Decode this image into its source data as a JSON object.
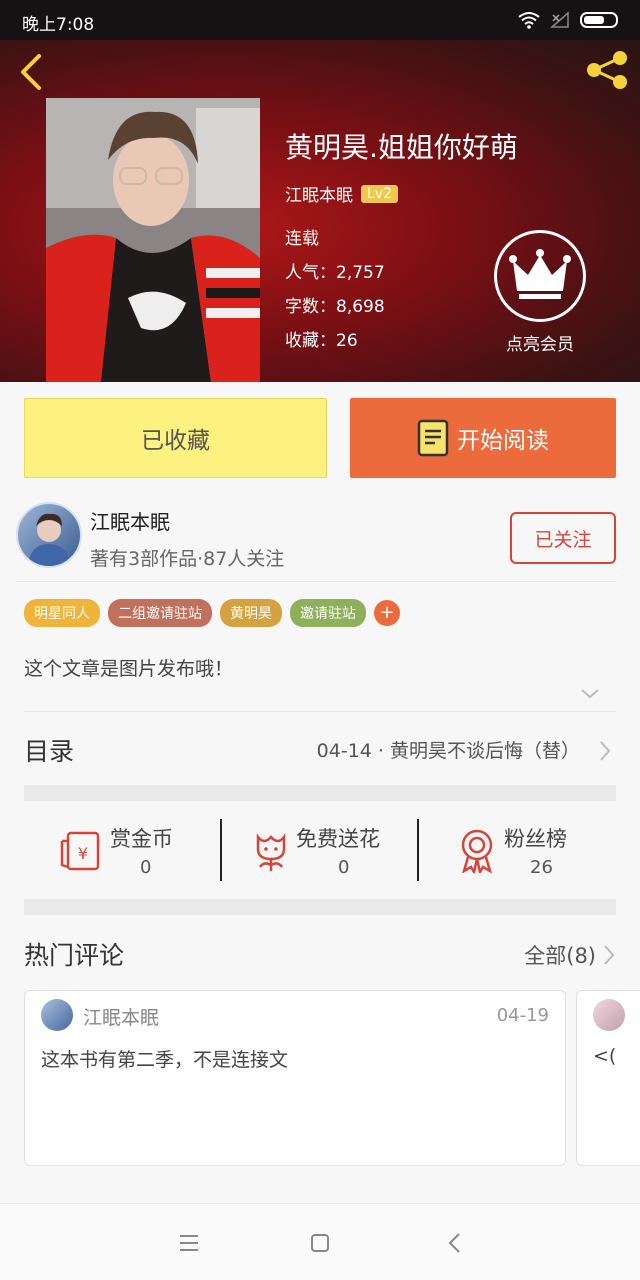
{
  "status_bar": {
    "time": "晚上7:08"
  },
  "book": {
    "title": "黄明昊.姐姐你好萌",
    "author": "江眠本眠",
    "level": "Lv2",
    "status": "连载",
    "popularity": "人气：2,757",
    "word_count": "字数：8,698",
    "favorites": "收藏：26",
    "member_label": "点亮会员"
  },
  "actions": {
    "collected_label": "已收藏",
    "read_label": "开始阅读"
  },
  "author_card": {
    "name": "江眠本眠",
    "meta": "著有3部作品·87人关注",
    "follow_label": "已关注"
  },
  "tags": [
    {
      "label": "明星同人",
      "color": "#f0b43a"
    },
    {
      "label": "二组邀请驻站",
      "color": "#c0705c"
    },
    {
      "label": "黄明昊",
      "color": "#d4a23e"
    },
    {
      "label": "邀请驻站",
      "color": "#8fb05a"
    }
  ],
  "tag_add": "+",
  "description": "这个文章是图片发布哦！",
  "toc": {
    "label": "目录",
    "latest": "04-14 · 黄明昊不谈后悔（替）"
  },
  "stats": [
    {
      "label": "赏金币",
      "value": "0",
      "icon": "red-envelope-yen-icon"
    },
    {
      "label": "免费送花",
      "value": "0",
      "icon": "flower-icon"
    },
    {
      "label": "粉丝榜",
      "value": "26",
      "icon": "medal-icon"
    }
  ],
  "hot_comments": {
    "title": "热门评论",
    "all_label": "全部(8)",
    "items": [
      {
        "user": "江眠本眠",
        "date": "04-19",
        "text": "这本书有第二季，不是连接文"
      },
      {
        "user": "",
        "date": "",
        "text": "<("
      }
    ]
  },
  "colors": {
    "accent": "#ec6b3c",
    "follow_red": "#d6453a",
    "collected_yellow": "#fdf280"
  }
}
